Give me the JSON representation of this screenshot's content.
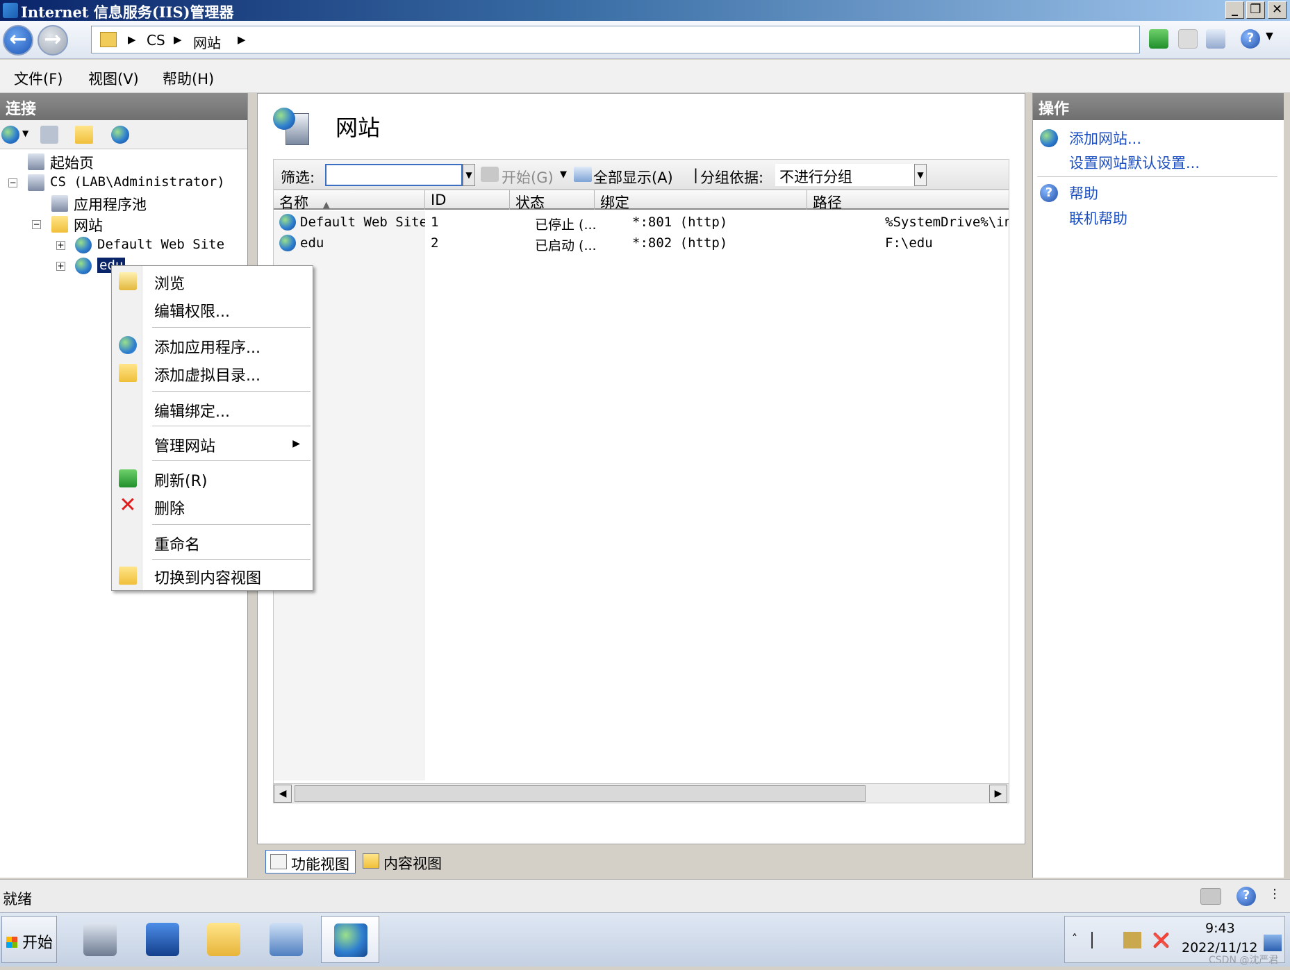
{
  "window": {
    "title": "Internet 信息服务(IIS)管理器",
    "min_glyph": "_",
    "max_glyph": "❐",
    "close_glyph": "✕"
  },
  "address": {
    "crumbs": [
      "CS",
      "网站"
    ]
  },
  "menubar": {
    "items": [
      "文件(F)",
      "视图(V)",
      "帮助(H)"
    ]
  },
  "connections": {
    "header": "连接",
    "tree": {
      "start_page": "起始页",
      "server": "CS (LAB\\Administrator)",
      "app_pools": "应用程序池",
      "sites": "网站",
      "default_site": "Default Web Site",
      "edu_site": "edu"
    }
  },
  "center": {
    "title": "网站",
    "filter": {
      "label": "筛选:",
      "value": "",
      "start": "开始(G)",
      "show_all": "全部显示(A)",
      "group_by_label": "分组依据:",
      "group_by_value": "不进行分组"
    },
    "columns": [
      "名称",
      "ID",
      "状态",
      "绑定",
      "路径"
    ],
    "rows": [
      {
        "name": "Default Web Site",
        "id": "1",
        "status": "已停止 (...",
        "binding": "*:801 (http)",
        "path": "%SystemDrive%\\in"
      },
      {
        "name": "edu",
        "id": "2",
        "status": "已启动 (...",
        "binding": "*:802 (http)",
        "path": "F:\\edu"
      }
    ],
    "view_tabs": {
      "features": "功能视图",
      "content": "内容视图"
    }
  },
  "actions": {
    "header": "操作",
    "add_site": "添加网站...",
    "site_defaults": "设置网站默认设置...",
    "help": "帮助",
    "online_help": "联机帮助"
  },
  "context_menu": {
    "browse": "浏览",
    "edit_permissions": "编辑权限...",
    "add_application": "添加应用程序...",
    "add_virtual_directory": "添加虚拟目录...",
    "edit_bindings": "编辑绑定...",
    "manage_website": "管理网站",
    "refresh": "刷新(R)",
    "delete": "删除",
    "rename": "重命名",
    "switch_content_view": "切换到内容视图"
  },
  "status": {
    "text": "就绪"
  },
  "taskbar": {
    "start": "开始",
    "time": "9:43",
    "date": "2022/11/12"
  },
  "watermark": "CSDN @沈严君",
  "colors": {
    "title_bar": "#0a246a",
    "link_blue": "#1a4ec2",
    "selection": "#0a246a",
    "delete_red": "#e01b1b"
  }
}
